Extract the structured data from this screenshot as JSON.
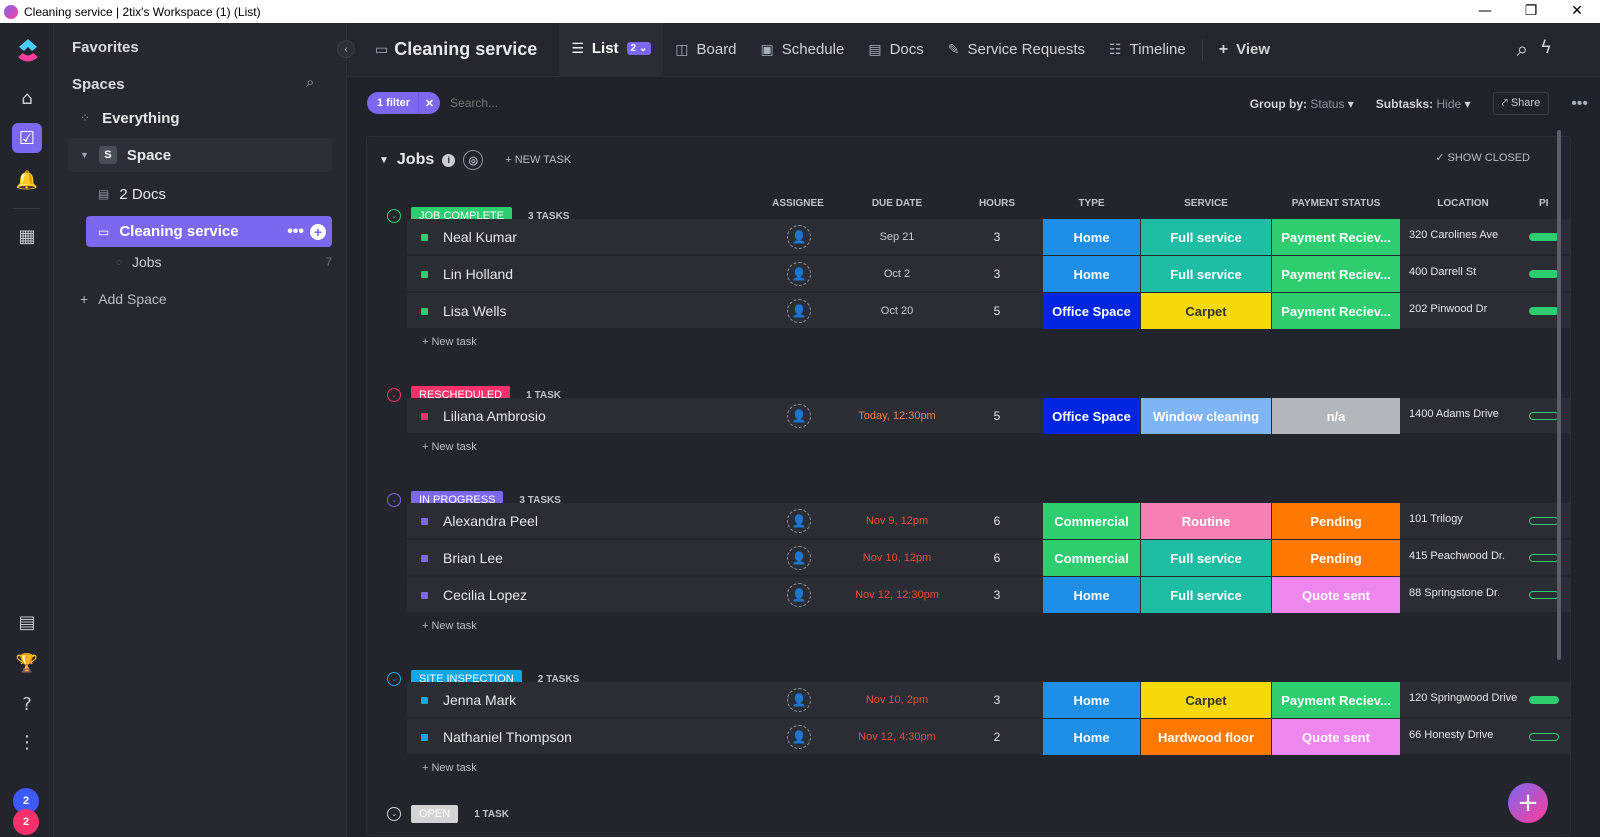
{
  "window": {
    "title": "Cleaning service | 2tix's Workspace (1) (List)",
    "minimize": "—",
    "maximize": "❐",
    "close": "✕"
  },
  "rail": {
    "icons": [
      "home-icon",
      "tasks-icon",
      "bell-icon",
      "apps-icon",
      "doc-icon",
      "trophy-icon",
      "help-icon",
      "more-icon"
    ],
    "avatar_count_top": "2",
    "avatar_count_bottom": "2"
  },
  "sidebar": {
    "favorites": "Favorites",
    "spaces": "Spaces",
    "everything": "Everything",
    "space": {
      "letter": "S",
      "label": "Space"
    },
    "docs": "2 Docs",
    "list_selected": "Cleaning service",
    "jobs": {
      "label": "Jobs",
      "count": "7"
    },
    "add_space": "Add Space"
  },
  "header": {
    "crumb": "Cleaning service",
    "tabs": [
      {
        "label": "List",
        "badge": "2 ⌄"
      },
      {
        "label": "Board"
      },
      {
        "label": "Schedule"
      },
      {
        "label": "Docs"
      },
      {
        "label": "Service Requests"
      },
      {
        "label": "Timeline"
      },
      {
        "label": "View"
      }
    ]
  },
  "toolbar": {
    "filter": "1 filter",
    "search_placeholder": "Search...",
    "group_by_label": "Group by:",
    "group_by_value": "Status",
    "subtasks_label": "Subtasks:",
    "subtasks_value": "Hide",
    "share": "Share"
  },
  "list": {
    "title": "Jobs",
    "new_task": "+ NEW TASK",
    "show_closed": "SHOW CLOSED",
    "add_task": "+ New task",
    "columns": {
      "assignee": "ASSIGNEE",
      "due": "DUE DATE",
      "hours": "HOURS",
      "type": "TYPE",
      "service": "SERVICE",
      "payment": "PAYMENT STATUS",
      "location": "LOCATION",
      "progress": "PI"
    },
    "groups": [
      {
        "status": "JOB COMPLETE",
        "count": "3 TASKS",
        "color": "#2ecd6f",
        "tasks": [
          {
            "name": "Neal Kumar",
            "due": "Sep 21",
            "hours": "3",
            "type": "Home",
            "service": "Full service",
            "payment": "Payment Reciev...",
            "location": "320 Carolines Ave"
          },
          {
            "name": "Lin Holland",
            "due": "Oct 2",
            "hours": "3",
            "type": "Home",
            "service": "Full service",
            "payment": "Payment Reciev...",
            "location": "400 Darrell St"
          },
          {
            "name": "Lisa Wells",
            "due": "Oct 20",
            "hours": "5",
            "type": "Office Space",
            "service": "Carpet",
            "payment": "Payment Reciev...",
            "location": "202 Pinwood Dr"
          }
        ]
      },
      {
        "status": "RESCHEDULED",
        "count": "1 TASK",
        "color": "#f9316a",
        "tasks": [
          {
            "name": "Liliana Ambrosio",
            "due": "Today, 12:30pm",
            "hours": "5",
            "type": "Office Space",
            "service": "Window cleaning",
            "payment": "n/a",
            "location": "1400 Adams Drive"
          }
        ]
      },
      {
        "status": "IN PROGRESS",
        "count": "3 TASKS",
        "color": "#7b68ee",
        "tasks": [
          {
            "name": "Alexandra Peel",
            "due": "Nov 9, 12pm",
            "hours": "6",
            "type": "Commercial",
            "service": "Routine",
            "payment": "Pending",
            "location": "101 Trilogy"
          },
          {
            "name": "Brian Lee",
            "due": "Nov 10, 12pm",
            "hours": "6",
            "type": "Commercial",
            "service": "Full service",
            "payment": "Pending",
            "location": "415 Peachwood Dr."
          },
          {
            "name": "Cecilia Lopez",
            "due": "Nov 12, 12:30pm",
            "hours": "3",
            "type": "Home",
            "service": "Full service",
            "payment": "Quote sent",
            "location": "88 Springstone Dr."
          }
        ]
      },
      {
        "status": "SITE INSPECTION",
        "count": "2 TASKS",
        "color": "#0fa7e6",
        "tasks": [
          {
            "name": "Jenna Mark",
            "due": "Nov 10, 2pm",
            "hours": "3",
            "type": "Home",
            "service": "Carpet",
            "payment": "Payment Reciev...",
            "location": "120 Springwood Drive"
          },
          {
            "name": "Nathaniel Thompson",
            "due": "Nov 12, 4:30pm",
            "hours": "2",
            "type": "Home",
            "service": "Hardwood floor",
            "payment": "Quote sent",
            "location": "66 Honesty Drive"
          }
        ]
      },
      {
        "status": "OPEN",
        "count": "1 TASK",
        "color": "#d3d3d3"
      }
    ]
  },
  "colors": {
    "accent": "#7b68ee",
    "home": "#1f8ee6",
    "office": "#0224e3",
    "commercial": "#2ecd6f",
    "full_service": "#1ebea5",
    "carpet": "#f5d90a",
    "window": "#7fb5f5",
    "routine": "#f77fb3",
    "hardwood": "#ff7800",
    "paid": "#2ecd6f",
    "na": "#b3b6bb",
    "pending": "#ff7800",
    "quote": "#ee86f0",
    "overdue": "#e74c3c",
    "today": "#ff7e45"
  }
}
